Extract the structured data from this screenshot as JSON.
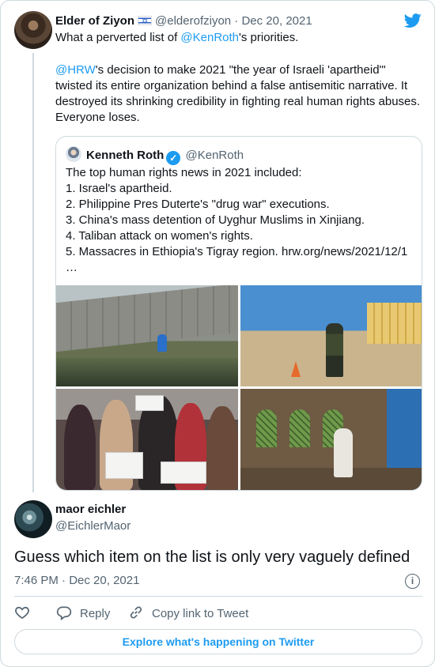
{
  "original_tweet": {
    "author_name": "Elder of Ziyon",
    "author_handle": "@elderofziyon",
    "separator": "·",
    "date": "Dec 20, 2021",
    "flag_icon": "israel-flag-icon",
    "line1_pre": "What a perverted list of ",
    "line1_link": "@KenRoth",
    "line1_post": "'s priorities.",
    "para2_link": "@HRW",
    "para2_line1": "'s decision to make 2021 \"the year of Israeli 'apartheid'\"",
    "para2_line2": "twisted its entire organization behind a false antisemitic narrative. It",
    "para2_line3": "destroyed its shrinking credibility in fighting real human rights abuses.",
    "para2_line4": "Everyone loses."
  },
  "quoted_tweet": {
    "author_name": "Kenneth Roth",
    "author_handle": "@KenRoth",
    "verified_icon": "verified-badge-icon",
    "lines": [
      "The top human rights news in 2021 included:",
      "1. Israel's apartheid.",
      "2. Philippine Pres Duterte's \"drug war\" executions.",
      "3. China's mass detention of Uyghur Muslims in Xinjiang.",
      "4. Taliban attack on women's rights.",
      "5. Massacres in Ethiopia's Tigray region. hrw.org/news/2021/12/1",
      "…"
    ]
  },
  "reply_tweet": {
    "author_name": "maor eichler",
    "author_handle": "@EichlerMaor",
    "text": "Guess which item on the list is only very vaguely defined",
    "time": "7:46 PM",
    "separator": "·",
    "date": "Dec 20, 2021"
  },
  "actions": {
    "reply_label": "Reply",
    "copy_link_label": "Copy link to Tweet"
  },
  "explore_label": "Explore what's happening on Twitter",
  "colors": {
    "link": "#1d9bf0",
    "text": "#0f1419",
    "secondary": "#536471",
    "border": "#cfd9de"
  }
}
